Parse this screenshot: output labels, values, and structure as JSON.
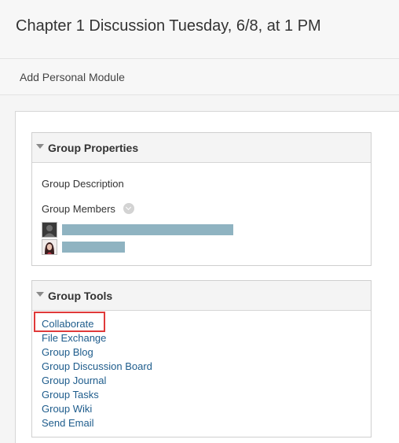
{
  "page": {
    "title": "Chapter 1 Discussion Tuesday, 6/8, at 1 PM",
    "add_module_label": "Add Personal Module"
  },
  "group_properties": {
    "title": "Group Properties",
    "description_label": "Group Description",
    "members_label": "Group Members",
    "members": [
      {
        "avatar": "generic-user-avatar",
        "name_redacted": true
      },
      {
        "avatar": "user-photo-avatar",
        "name_redacted": true
      }
    ]
  },
  "group_tools": {
    "title": "Group Tools",
    "highlighted": "Collaborate",
    "items": [
      {
        "label": "Collaborate"
      },
      {
        "label": "File Exchange"
      },
      {
        "label": "Group Blog"
      },
      {
        "label": "Group Discussion Board"
      },
      {
        "label": "Group Journal"
      },
      {
        "label": "Group Tasks"
      },
      {
        "label": "Group Wiki"
      },
      {
        "label": "Send Email"
      }
    ]
  },
  "colors": {
    "link": "#1e5c8c",
    "highlight": "#e03a3a",
    "redaction": "#8fb3c1"
  }
}
